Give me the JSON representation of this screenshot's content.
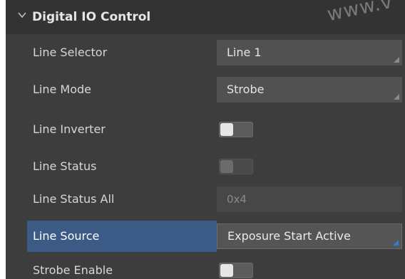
{
  "panel": {
    "section_title": "Digital IO Control",
    "watermark": "www.v",
    "rows": [
      {
        "label": "Line Selector",
        "type": "dropdown",
        "value": "Line 1"
      },
      {
        "label": "Line Mode",
        "type": "dropdown",
        "value": "Strobe"
      },
      {
        "label": "Line Inverter",
        "type": "toggle",
        "on": false,
        "enabled": true
      },
      {
        "label": "Line Status",
        "type": "toggle",
        "on": false,
        "enabled": false
      },
      {
        "label": "Line Status All",
        "type": "readonly",
        "value": "0x4"
      },
      {
        "label": "Line Source",
        "type": "dropdown",
        "value": "Exposure Start Active",
        "selected": true
      },
      {
        "label": "Strobe Enable",
        "type": "toggle",
        "on": false,
        "enabled": true
      }
    ]
  },
  "colors": {
    "background": "#3d3d3d",
    "header": "#333333",
    "selected_row": "#3b5a86",
    "corner_accent": "#2f7fd6",
    "text": "#d7d7d7"
  }
}
